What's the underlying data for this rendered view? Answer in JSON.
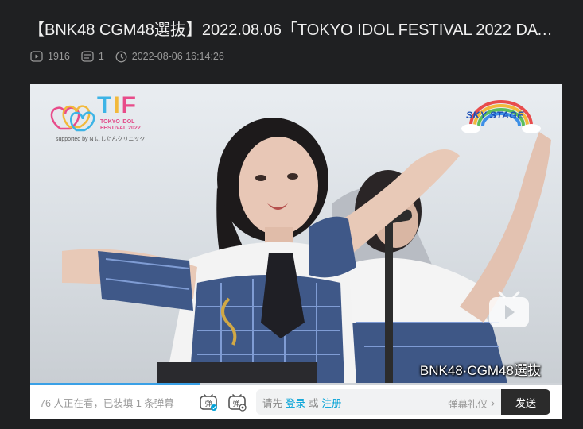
{
  "video": {
    "title": "【BNK48 CGM48選抜】2022.08.06「TOKYO IDOL FESTIVAL 2022 DAY…",
    "views": "1916",
    "danmaku_count": "1",
    "published": "2022-08-06 16:14:26",
    "progress_fraction": 0.32
  },
  "overlay": {
    "tif_letters": "TIF",
    "tif_sub_line1": "TOKYO IDOL",
    "tif_sub_line2": "FESTIVAL 2022",
    "tif_sponsor": "supported by N にしたんクリニック",
    "sky_stage": "SKY STAGE",
    "caption": "BNK48·CGM48選抜"
  },
  "danmaku_bar": {
    "viewers": "76 人正在看，已装填 1 条弹幕",
    "prompt_prefix": "请先",
    "login": "登录",
    "or": "或",
    "register": "注册",
    "etiquette": "弹幕礼仪",
    "etiquette_arrow": "›",
    "send": "发送"
  },
  "colors": {
    "page_bg": "#1f2022",
    "accent_link": "#00a1d6",
    "progress": "#3aa0e6",
    "send_bg": "#2b2b2b"
  },
  "icons": [
    "play-count-icon",
    "danmaku-count-icon",
    "clock-icon",
    "danmaku-toggle-icon",
    "danmaku-settings-icon",
    "bilibili-play-icon"
  ]
}
